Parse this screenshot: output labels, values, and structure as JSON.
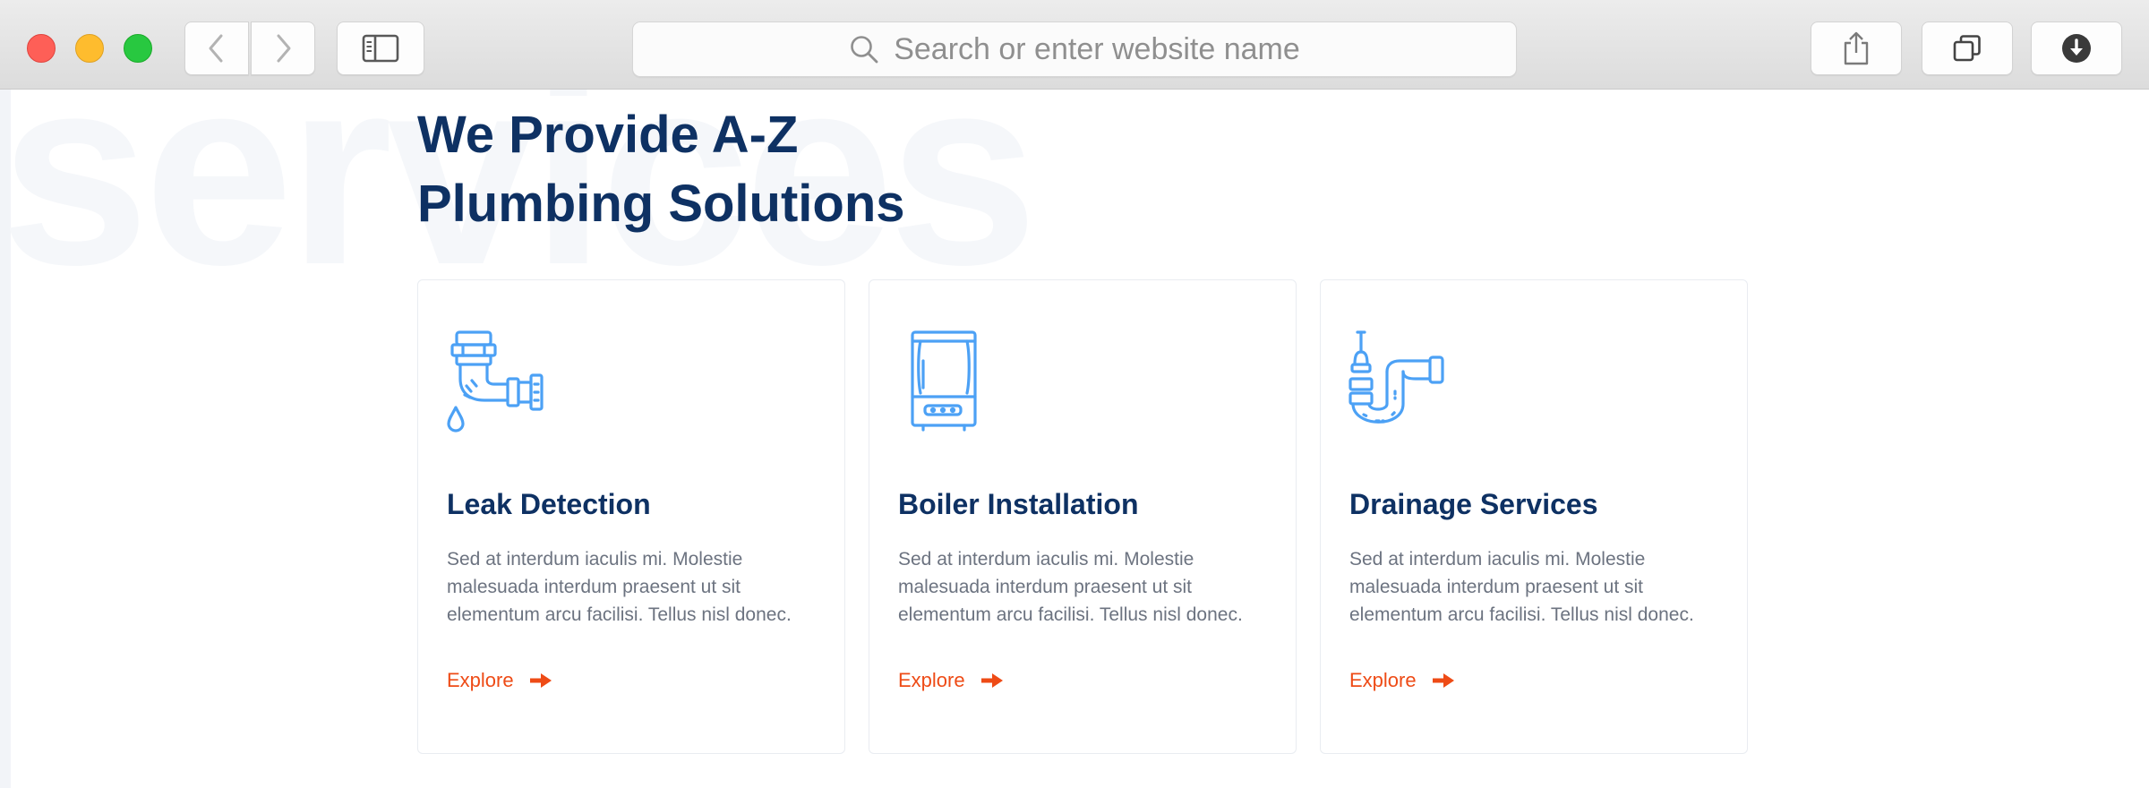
{
  "browser": {
    "address_placeholder": "Search or enter website name",
    "icons": [
      "back-icon",
      "forward-icon",
      "sidebar-icon",
      "search-icon",
      "share-icon",
      "tabs-icon",
      "download-icon"
    ]
  },
  "page": {
    "watermark": "services",
    "heading_line1": "We Provide A-Z",
    "heading_line2": "Plumbing Solutions",
    "colors": {
      "heading": "#0e3163",
      "accent": "#ee4b16",
      "icon": "#4ca1f5",
      "text": "#6c7380"
    },
    "services": [
      {
        "icon": "leaking-pipe-icon",
        "title": "Leak Detection",
        "description": "Sed at interdum iaculis mi. Molestie malesuada interdum praesent ut sit elementum arcu facilisi. Tellus nisl donec.",
        "link_label": "Explore"
      },
      {
        "icon": "boiler-icon",
        "title": "Boiler Installation",
        "description": "Sed at interdum iaculis mi. Molestie malesuada interdum praesent ut sit elementum arcu facilisi. Tellus nisl donec.",
        "link_label": "Explore"
      },
      {
        "icon": "drain-pipe-icon",
        "title": "Drainage Services",
        "description": "Sed at interdum iaculis mi. Molestie malesuada interdum praesent ut sit elementum arcu facilisi. Tellus nisl donec.",
        "link_label": "Explore"
      }
    ]
  }
}
